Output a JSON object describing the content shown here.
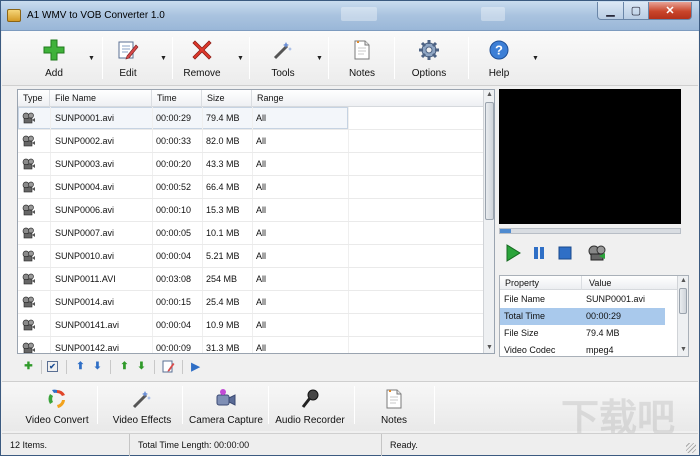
{
  "window": {
    "title": "A1 WMV to VOB Converter 1.0"
  },
  "toolbar": {
    "add": "Add",
    "edit": "Edit",
    "remove": "Remove",
    "tools": "Tools",
    "notes": "Notes",
    "options": "Options",
    "help": "Help"
  },
  "filelist": {
    "columns": [
      "Type",
      "File Name",
      "Time",
      "Size",
      "Range"
    ],
    "rows": [
      {
        "name": "SUNP0001.avi",
        "time": "00:00:29",
        "size": "79.4 MB",
        "range": "All"
      },
      {
        "name": "SUNP0002.avi",
        "time": "00:00:33",
        "size": "82.0 MB",
        "range": "All"
      },
      {
        "name": "SUNP0003.avi",
        "time": "00:00:20",
        "size": "43.3 MB",
        "range": "All"
      },
      {
        "name": "SUNP0004.avi",
        "time": "00:00:52",
        "size": "66.4 MB",
        "range": "All"
      },
      {
        "name": "SUNP0006.avi",
        "time": "00:00:10",
        "size": "15.3 MB",
        "range": "All"
      },
      {
        "name": "SUNP0007.avi",
        "time": "00:00:05",
        "size": "10.1 MB",
        "range": "All"
      },
      {
        "name": "SUNP0010.avi",
        "time": "00:00:04",
        "size": "5.21 MB",
        "range": "All"
      },
      {
        "name": "SUNP0011.AVI",
        "time": "00:03:08",
        "size": "254 MB",
        "range": "All"
      },
      {
        "name": "SUNP0014.avi",
        "time": "00:00:15",
        "size": "25.4 MB",
        "range": "All"
      },
      {
        "name": "SUNP00141.avi",
        "time": "00:00:04",
        "size": "10.9 MB",
        "range": "All"
      },
      {
        "name": "SUNP00142.avi",
        "time": "00:00:09",
        "size": "31.3 MB",
        "range": "All"
      }
    ]
  },
  "properties": {
    "columns": [
      "Property",
      "Value"
    ],
    "rows": [
      {
        "property": "File Name",
        "value": "SUNP0001.avi"
      },
      {
        "property": "Total Time",
        "value": "00:00:29"
      },
      {
        "property": "File Size",
        "value": "79.4 MB"
      },
      {
        "property": "Video Codec",
        "value": "mpeg4"
      }
    ]
  },
  "bottombar": {
    "video_convert": "Video Convert",
    "video_effects": "Video Effects",
    "camera_capture": "Camera Capture",
    "audio_recorder": "Audio Recorder",
    "notes": "Notes"
  },
  "status": {
    "items": "12 Items.",
    "total_time": "Total Time Length: 00:00:00",
    "state": "Ready."
  },
  "colors": {
    "accent": "#4f8bd0",
    "selection": "#a9c9ec",
    "play_green": "#2aa43a"
  }
}
